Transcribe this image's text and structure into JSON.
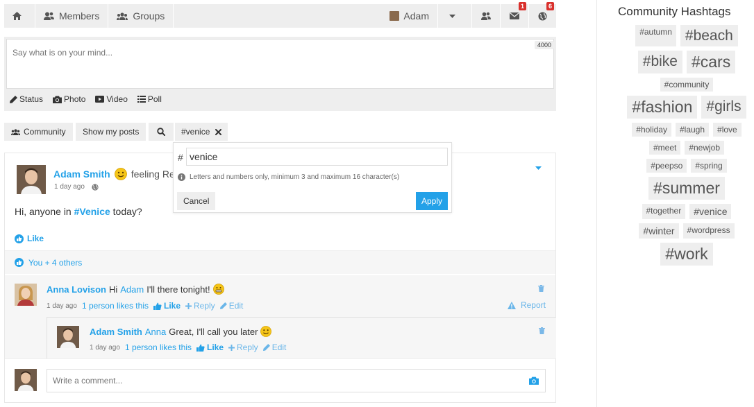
{
  "nav": {
    "members": "Members",
    "groups": "Groups",
    "user": "Adam",
    "messages_badge": "1",
    "notifications_badge": "6"
  },
  "postbox": {
    "placeholder": "Say what is on your mind...",
    "char_limit": "4000",
    "tabs": [
      "Status",
      "Photo",
      "Video",
      "Poll"
    ]
  },
  "filters": {
    "community": "Community",
    "my_posts": "Show my posts",
    "active_hashtag": "#venice"
  },
  "hashtag_dropdown": {
    "hash": "#",
    "value": "venice",
    "hint": "Letters and numbers only, minimum 3 and maximum 16 character(s)",
    "cancel": "Cancel",
    "apply": "Apply"
  },
  "post": {
    "author": "Adam Smith",
    "feeling": "feeling Re",
    "time": "1 day ago",
    "text_before": "Hi, anyone in ",
    "hashtag": "#Venice",
    "text_after": " today?",
    "like": "Like",
    "likes_summary": "You + 4 others"
  },
  "comments": [
    {
      "author": "Anna Lovison",
      "text_before": "Hi",
      "mention": "Adam",
      "text_after": "I'll there tonight!",
      "time": "1 day ago",
      "likes": "1 person likes this",
      "like": "Like",
      "reply": "Reply",
      "edit": "Edit",
      "report": "Report"
    },
    {
      "author": "Adam Smith",
      "mention": "Anna",
      "text_after": "Great, I'll call you later",
      "time": "1 day ago",
      "likes": "1 person likes this",
      "like": "Like",
      "reply": "Reply",
      "edit": "Edit"
    }
  ],
  "comment_input": {
    "placeholder": "Write a comment..."
  },
  "sidebar": {
    "title": "Community Hashtags",
    "rows": [
      [
        {
          "t": "#autumn",
          "s": 12
        },
        {
          "t": "#beach",
          "s": 21
        }
      ],
      [
        {
          "t": "#bike",
          "s": 21
        },
        {
          "t": "#cars",
          "s": 23
        }
      ],
      [
        {
          "t": "#community",
          "s": 12
        }
      ],
      [
        {
          "t": "#fashion",
          "s": 23
        },
        {
          "t": "#girls",
          "s": 21
        }
      ],
      [
        {
          "t": "#holiday",
          "s": 12
        },
        {
          "t": "#laugh",
          "s": 12
        },
        {
          "t": "#love",
          "s": 12
        }
      ],
      [
        {
          "t": "#meet",
          "s": 12
        },
        {
          "t": "#newjob",
          "s": 12
        }
      ],
      [
        {
          "t": "#peepso",
          "s": 12
        },
        {
          "t": "#spring",
          "s": 12
        }
      ],
      [
        {
          "t": "#summer",
          "s": 23
        }
      ],
      [
        {
          "t": "#together",
          "s": 12
        },
        {
          "t": "#venice",
          "s": 14
        }
      ],
      [
        {
          "t": "#winter",
          "s": 14
        },
        {
          "t": "#wordpress",
          "s": 12
        }
      ],
      [
        {
          "t": "#work",
          "s": 23
        }
      ]
    ]
  },
  "colors": {
    "accent": "#23a1e8",
    "badge": "#d9302c",
    "panel": "#eeeeee"
  }
}
